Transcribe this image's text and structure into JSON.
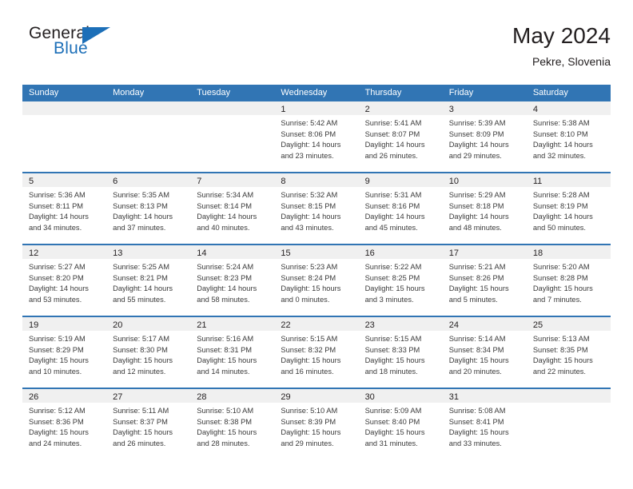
{
  "brand": {
    "name_part1": "General",
    "name_part2": "Blue",
    "mark": "triangle-logo"
  },
  "header": {
    "title": "May 2024",
    "subtitle": "Pekre, Slovenia"
  },
  "colors": {
    "header_blue": "#3175b4",
    "brand_blue": "#1c6fb8",
    "daynum_band": "#f0f0f0",
    "text": "#231f20"
  },
  "weekdays": [
    "Sunday",
    "Monday",
    "Tuesday",
    "Wednesday",
    "Thursday",
    "Friday",
    "Saturday"
  ],
  "weeks": [
    [
      {
        "day": "",
        "lines": []
      },
      {
        "day": "",
        "lines": []
      },
      {
        "day": "",
        "lines": []
      },
      {
        "day": "1",
        "lines": [
          "Sunrise: 5:42 AM",
          "Sunset: 8:06 PM",
          "Daylight: 14 hours and 23 minutes."
        ]
      },
      {
        "day": "2",
        "lines": [
          "Sunrise: 5:41 AM",
          "Sunset: 8:07 PM",
          "Daylight: 14 hours and 26 minutes."
        ]
      },
      {
        "day": "3",
        "lines": [
          "Sunrise: 5:39 AM",
          "Sunset: 8:09 PM",
          "Daylight: 14 hours and 29 minutes."
        ]
      },
      {
        "day": "4",
        "lines": [
          "Sunrise: 5:38 AM",
          "Sunset: 8:10 PM",
          "Daylight: 14 hours and 32 minutes."
        ]
      }
    ],
    [
      {
        "day": "5",
        "lines": [
          "Sunrise: 5:36 AM",
          "Sunset: 8:11 PM",
          "Daylight: 14 hours and 34 minutes."
        ]
      },
      {
        "day": "6",
        "lines": [
          "Sunrise: 5:35 AM",
          "Sunset: 8:13 PM",
          "Daylight: 14 hours and 37 minutes."
        ]
      },
      {
        "day": "7",
        "lines": [
          "Sunrise: 5:34 AM",
          "Sunset: 8:14 PM",
          "Daylight: 14 hours and 40 minutes."
        ]
      },
      {
        "day": "8",
        "lines": [
          "Sunrise: 5:32 AM",
          "Sunset: 8:15 PM",
          "Daylight: 14 hours and 43 minutes."
        ]
      },
      {
        "day": "9",
        "lines": [
          "Sunrise: 5:31 AM",
          "Sunset: 8:16 PM",
          "Daylight: 14 hours and 45 minutes."
        ]
      },
      {
        "day": "10",
        "lines": [
          "Sunrise: 5:29 AM",
          "Sunset: 8:18 PM",
          "Daylight: 14 hours and 48 minutes."
        ]
      },
      {
        "day": "11",
        "lines": [
          "Sunrise: 5:28 AM",
          "Sunset: 8:19 PM",
          "Daylight: 14 hours and 50 minutes."
        ]
      }
    ],
    [
      {
        "day": "12",
        "lines": [
          "Sunrise: 5:27 AM",
          "Sunset: 8:20 PM",
          "Daylight: 14 hours and 53 minutes."
        ]
      },
      {
        "day": "13",
        "lines": [
          "Sunrise: 5:25 AM",
          "Sunset: 8:21 PM",
          "Daylight: 14 hours and 55 minutes."
        ]
      },
      {
        "day": "14",
        "lines": [
          "Sunrise: 5:24 AM",
          "Sunset: 8:23 PM",
          "Daylight: 14 hours and 58 minutes."
        ]
      },
      {
        "day": "15",
        "lines": [
          "Sunrise: 5:23 AM",
          "Sunset: 8:24 PM",
          "Daylight: 15 hours and 0 minutes."
        ]
      },
      {
        "day": "16",
        "lines": [
          "Sunrise: 5:22 AM",
          "Sunset: 8:25 PM",
          "Daylight: 15 hours and 3 minutes."
        ]
      },
      {
        "day": "17",
        "lines": [
          "Sunrise: 5:21 AM",
          "Sunset: 8:26 PM",
          "Daylight: 15 hours and 5 minutes."
        ]
      },
      {
        "day": "18",
        "lines": [
          "Sunrise: 5:20 AM",
          "Sunset: 8:28 PM",
          "Daylight: 15 hours and 7 minutes."
        ]
      }
    ],
    [
      {
        "day": "19",
        "lines": [
          "Sunrise: 5:19 AM",
          "Sunset: 8:29 PM",
          "Daylight: 15 hours and 10 minutes."
        ]
      },
      {
        "day": "20",
        "lines": [
          "Sunrise: 5:17 AM",
          "Sunset: 8:30 PM",
          "Daylight: 15 hours and 12 minutes."
        ]
      },
      {
        "day": "21",
        "lines": [
          "Sunrise: 5:16 AM",
          "Sunset: 8:31 PM",
          "Daylight: 15 hours and 14 minutes."
        ]
      },
      {
        "day": "22",
        "lines": [
          "Sunrise: 5:15 AM",
          "Sunset: 8:32 PM",
          "Daylight: 15 hours and 16 minutes."
        ]
      },
      {
        "day": "23",
        "lines": [
          "Sunrise: 5:15 AM",
          "Sunset: 8:33 PM",
          "Daylight: 15 hours and 18 minutes."
        ]
      },
      {
        "day": "24",
        "lines": [
          "Sunrise: 5:14 AM",
          "Sunset: 8:34 PM",
          "Daylight: 15 hours and 20 minutes."
        ]
      },
      {
        "day": "25",
        "lines": [
          "Sunrise: 5:13 AM",
          "Sunset: 8:35 PM",
          "Daylight: 15 hours and 22 minutes."
        ]
      }
    ],
    [
      {
        "day": "26",
        "lines": [
          "Sunrise: 5:12 AM",
          "Sunset: 8:36 PM",
          "Daylight: 15 hours and 24 minutes."
        ]
      },
      {
        "day": "27",
        "lines": [
          "Sunrise: 5:11 AM",
          "Sunset: 8:37 PM",
          "Daylight: 15 hours and 26 minutes."
        ]
      },
      {
        "day": "28",
        "lines": [
          "Sunrise: 5:10 AM",
          "Sunset: 8:38 PM",
          "Daylight: 15 hours and 28 minutes."
        ]
      },
      {
        "day": "29",
        "lines": [
          "Sunrise: 5:10 AM",
          "Sunset: 8:39 PM",
          "Daylight: 15 hours and 29 minutes."
        ]
      },
      {
        "day": "30",
        "lines": [
          "Sunrise: 5:09 AM",
          "Sunset: 8:40 PM",
          "Daylight: 15 hours and 31 minutes."
        ]
      },
      {
        "day": "31",
        "lines": [
          "Sunrise: 5:08 AM",
          "Sunset: 8:41 PM",
          "Daylight: 15 hours and 33 minutes."
        ]
      },
      {
        "day": "",
        "lines": []
      }
    ]
  ]
}
